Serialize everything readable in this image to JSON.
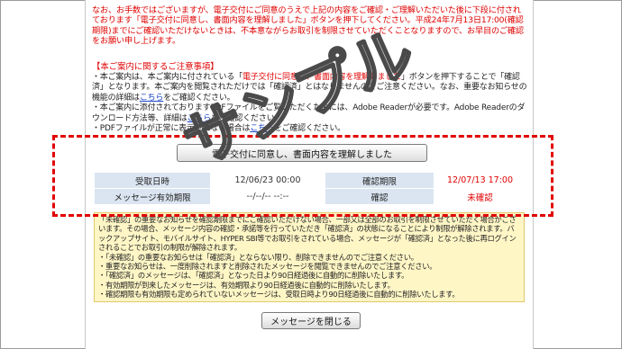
{
  "red_notice": {
    "text": "なお、お手数ではございますが、電子交付にご同意のうえで上記の内容をご確認・ご理解いただいた後に下段に付されております「電子交付に同意し、書面内容を理解しました」ボタンを押下してください。平成24年7月13日17:00(確認期限)までにご確認いただけないときは、不本意ながらお取引を制限させていただくことなりますので、お早目のご確認をお願い申し上げます。"
  },
  "notice_title": "【本ご案内に関するご注意事項】",
  "notice_body": {
    "p1_a": "・本ご案内は、本ご案内に付されている「",
    "p1_hl": "電子交付に同意し、書面内容を理解しました",
    "p1_b": "」ボタンを押下することで「確認済」となります。本ご案内を閲覧されただけでは「確認済」とはなりませんのでご注意ください。なお、重要なお知らせの機能の詳細は",
    "p1_link": "こちら",
    "p1_c": "をご確認ください。",
    "p2_a": "・本ご案内に添付されておりますPDFファイルをご覧いただくためには、Adobe Readerが必要です。Adobe Readerのダウンロード方法等、詳細は",
    "p2_link": "こちら",
    "p2_b": "をご確認ください。",
    "p3_a": "・PDFファイルが正常に表示されない場合は",
    "p3_link": "こちら",
    "p3_b": "をご確認ください。"
  },
  "agree_button": "電子交付に同意し、書面内容を理解しました",
  "info_table": {
    "received_label": "受取日時",
    "received_value": "12/06/23 00:00",
    "deadline_label": "確認期限",
    "deadline_value": "12/07/13 17:00",
    "expiry_label": "メッセージ有効期限",
    "expiry_value": "--/--/-- --:--",
    "status_label": "確認",
    "status_value": "未確認"
  },
  "yellow_notes": {
    "p1": "「未確認」の重要なお知らせを確認期限までにご確認いただけない場合、一部又は全部のお取引を制限させていただく場合がございます。その場合、メッセージ内容の確認・承諾等を行っていただき「確認済」の状態になることにより制限が解除されます。バックアップサイト、モバイルサイト、HYPER SBI等でお取引をされている場合、メッセージが「確認済」となった後に再ログインされることでお取引の制限が解除されます。",
    "p2": "・「未確認」の重要なお知らせは「確認済」とならない限り、削除できませんのでご注意ください。",
    "p3": "・重要なお知らせは、一度削除されますと削除されたメッセージを閲覧できませんのでご注意ください。",
    "p4": "・「確認済」のメッセージは、「確認済」となった日より90日経過後に自動的に削除いたします。",
    "p5": "・有効期限が到来したメッセージは、有効期限より90日経過後に自動的に削除いたします。",
    "p6": "・確認期限も有効期限も定められていないメッセージは、受取日時より90日経過後に自動的に削除いたします。"
  },
  "close_button": "メッセージを閉じる",
  "watermark_text": "サンプル",
  "colors": {
    "red": "#e00000",
    "table_label_bg": "#dbe5f1",
    "note_bg": "#fff6c6",
    "link": "#1a44c8"
  }
}
